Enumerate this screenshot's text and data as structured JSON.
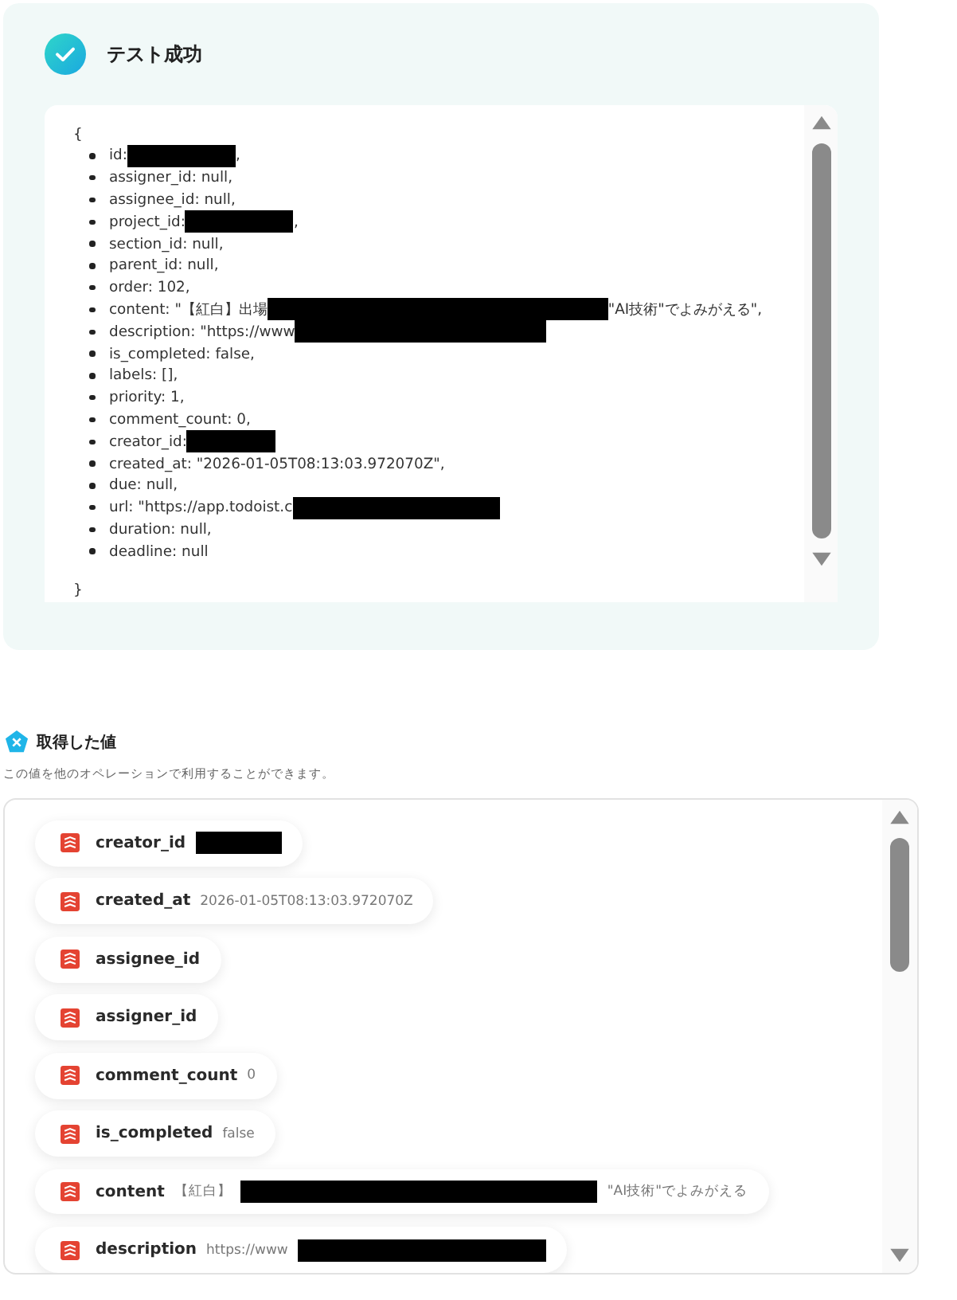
{
  "result": {
    "title": "テスト成功",
    "open_brace": "{",
    "close_brace": "}",
    "lines": [
      {
        "text": "id: ",
        "redacted": true,
        "after": ","
      },
      {
        "text": "assigner_id: null,"
      },
      {
        "text": "assignee_id: null,"
      },
      {
        "text": "project_id: ",
        "redacted": true,
        "after": ","
      },
      {
        "text": "section_id: null,"
      },
      {
        "text": "parent_id: null,"
      },
      {
        "text": "order: 102,"
      },
      {
        "text": "content: \"【紅白】出場",
        "redacted": true,
        "after": "\"AI技術\"でよみがえる\","
      },
      {
        "text": "description: \"https://www",
        "redacted": true
      },
      {
        "text": "is_completed: false,"
      },
      {
        "text": "labels: [],"
      },
      {
        "text": "priority: 1,"
      },
      {
        "text": "comment_count: 0,"
      },
      {
        "text": "creator_id: ",
        "redacted": true
      },
      {
        "text": "created_at: \"2026-01-05T08:13:03.972070Z\","
      },
      {
        "text": "due: null,"
      },
      {
        "text": "url: \"https://app.todoist.c",
        "redacted": true
      },
      {
        "text": "duration: null,"
      },
      {
        "text": "deadline: null"
      }
    ]
  },
  "values": {
    "title": "取得した値",
    "subtitle": "この値を他のオペレーションで利用することができます。",
    "items": [
      {
        "key": "creator_id",
        "redacted": true
      },
      {
        "key": "created_at",
        "value": "2026-01-05T08:13:03.972070Z"
      },
      {
        "key": "assignee_id"
      },
      {
        "key": "assigner_id"
      },
      {
        "key": "comment_count",
        "value": "0"
      },
      {
        "key": "is_completed",
        "value": "false"
      },
      {
        "key": "content",
        "value": "【紅白】",
        "redacted": true,
        "after": "\"AI技術\"でよみがえる"
      },
      {
        "key": "description",
        "value": "https://www",
        "redacted": true
      }
    ]
  }
}
